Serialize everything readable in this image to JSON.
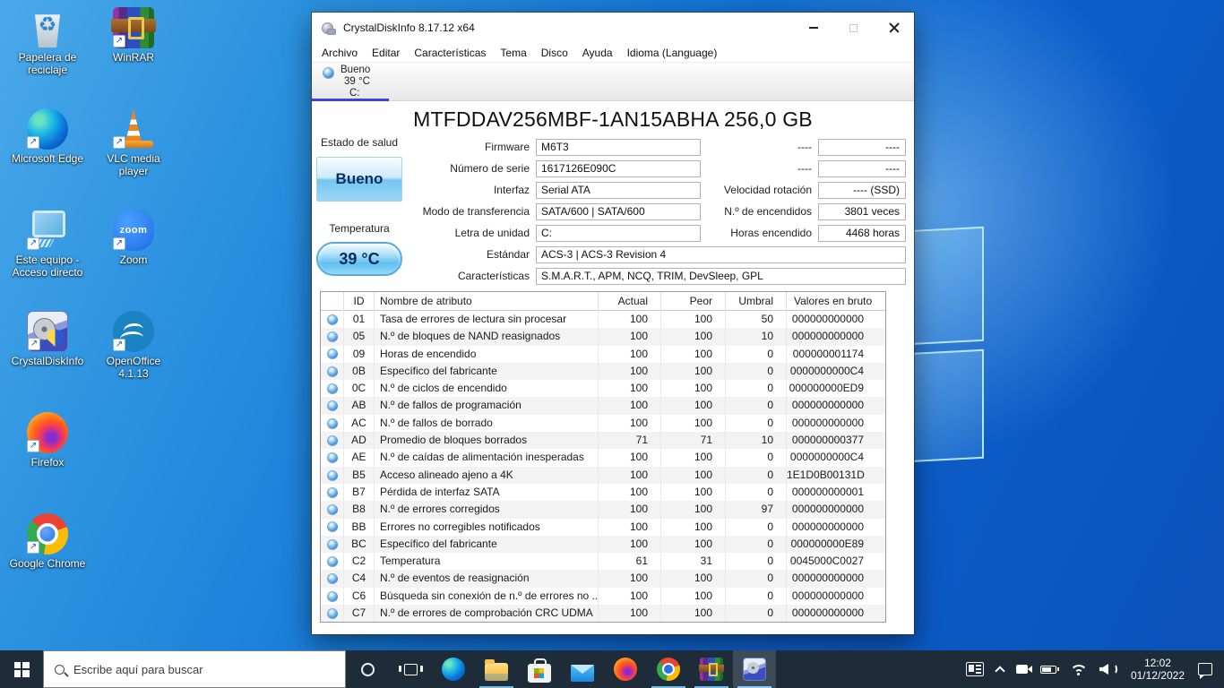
{
  "desktop": {
    "icons": [
      {
        "label": "Papelera de reciclaje",
        "icon": "recycle-bin"
      },
      {
        "label": "Microsoft Edge",
        "icon": "edge"
      },
      {
        "label": "Este equipo - Acceso directo",
        "icon": "this-pc"
      },
      {
        "label": "CrystalDiskInfo",
        "icon": "crystaldiskinfo"
      },
      {
        "label": "Firefox",
        "icon": "firefox"
      },
      {
        "label": "Google Chrome",
        "icon": "chrome"
      },
      {
        "label": "WinRAR",
        "icon": "winrar"
      },
      {
        "label": "VLC media player",
        "icon": "vlc"
      },
      {
        "label": "Zoom",
        "icon": "zoom"
      },
      {
        "label": "OpenOffice 4.1.13",
        "icon": "openoffice"
      }
    ]
  },
  "window": {
    "title": "CrystalDiskInfo 8.17.12 x64",
    "menu": [
      "Archivo",
      "Editar",
      "Características",
      "Tema",
      "Disco",
      "Ayuda",
      "Idioma (Language)"
    ],
    "drive_tab": {
      "health": "Bueno",
      "temp": "39 °C",
      "letter": "C:"
    },
    "disk_title": "MTFDDAV256MBF-1AN15ABHA 256,0 GB",
    "health_label": "Estado de salud",
    "health_value": "Bueno",
    "temp_label": "Temperatura",
    "temp_value": "39 °C",
    "fields": [
      {
        "label": "Firmware",
        "value": "M6T3",
        "wide": ""
      },
      {
        "label": "Número de serie",
        "value": "1617126E090C",
        "wide": ""
      },
      {
        "label": "Interfaz",
        "value": "Serial ATA",
        "wide": ""
      },
      {
        "label": "Modo de transferencia",
        "value": "SATA/600 | SATA/600",
        "wide": ""
      },
      {
        "label": "Letra de unidad",
        "value": "C:",
        "wide": ""
      },
      {
        "label": "Estándar",
        "value": "ACS-3 | ACS-3 Revision 4",
        "wide": "wide"
      },
      {
        "label": "Características",
        "value": "S.M.A.R.T., APM, NCQ, TRIM, DevSleep, GPL",
        "wide": "wide"
      }
    ],
    "right_fields": [
      {
        "label": "----",
        "value": "----"
      },
      {
        "label": "----",
        "value": "----"
      },
      {
        "label": "Velocidad rotación",
        "value": "---- (SSD)"
      },
      {
        "label": "N.º de encendidos",
        "value": "3801 veces"
      },
      {
        "label": "Horas encendido",
        "value": "4468 horas"
      }
    ],
    "table": {
      "headers": {
        "id": "ID",
        "name": "Nombre de atributo",
        "current": "Actual",
        "worst": "Peor",
        "threshold": "Umbral",
        "raw": "Valores en bruto"
      },
      "rows": [
        {
          "id": "01",
          "name": "Tasa de errores de lectura sin procesar",
          "current": "100",
          "worst": "100",
          "threshold": "50",
          "raw": "000000000000"
        },
        {
          "id": "05",
          "name": "N.º de bloques de NAND reasignados",
          "current": "100",
          "worst": "100",
          "threshold": "10",
          "raw": "000000000000"
        },
        {
          "id": "09",
          "name": "Horas de encendido",
          "current": "100",
          "worst": "100",
          "threshold": "0",
          "raw": "000000001174"
        },
        {
          "id": "0B",
          "name": "Específico del fabricante",
          "current": "100",
          "worst": "100",
          "threshold": "0",
          "raw": "0000000000C4"
        },
        {
          "id": "0C",
          "name": "N.º de ciclos de encendido",
          "current": "100",
          "worst": "100",
          "threshold": "0",
          "raw": "000000000ED9"
        },
        {
          "id": "AB",
          "name": "N.º de fallos de programación",
          "current": "100",
          "worst": "100",
          "threshold": "0",
          "raw": "000000000000"
        },
        {
          "id": "AC",
          "name": "N.º de fallos de borrado",
          "current": "100",
          "worst": "100",
          "threshold": "0",
          "raw": "000000000000"
        },
        {
          "id": "AD",
          "name": "Promedio de bloques borrados",
          "current": "71",
          "worst": "71",
          "threshold": "10",
          "raw": "000000000377"
        },
        {
          "id": "AE",
          "name": "N.º de caídas de alimentación inesperadas",
          "current": "100",
          "worst": "100",
          "threshold": "0",
          "raw": "0000000000C4"
        },
        {
          "id": "B5",
          "name": "Acceso alineado ajeno a 4K",
          "current": "100",
          "worst": "100",
          "threshold": "0",
          "raw": "1E1D0B00131D"
        },
        {
          "id": "B7",
          "name": "Pérdida de interfaz SATA",
          "current": "100",
          "worst": "100",
          "threshold": "0",
          "raw": "000000000001"
        },
        {
          "id": "B8",
          "name": "N.º de errores corregidos",
          "current": "100",
          "worst": "100",
          "threshold": "97",
          "raw": "000000000000"
        },
        {
          "id": "BB",
          "name": "Errores no corregibles notificados",
          "current": "100",
          "worst": "100",
          "threshold": "0",
          "raw": "000000000000"
        },
        {
          "id": "BC",
          "name": "Específico del fabricante",
          "current": "100",
          "worst": "100",
          "threshold": "0",
          "raw": "000000000E89"
        },
        {
          "id": "C2",
          "name": "Temperatura",
          "current": "61",
          "worst": "31",
          "threshold": "0",
          "raw": "0045000C0027"
        },
        {
          "id": "C4",
          "name": "N.º de eventos de reasignación",
          "current": "100",
          "worst": "100",
          "threshold": "0",
          "raw": "000000000000"
        },
        {
          "id": "C6",
          "name": "Búsqueda sin conexión de n.º de errores no ...",
          "current": "100",
          "worst": "100",
          "threshold": "0",
          "raw": "000000000000"
        },
        {
          "id": "C7",
          "name": "N.º de errores de comprobación CRC UDMA",
          "current": "100",
          "worst": "100",
          "threshold": "0",
          "raw": "000000000000"
        }
      ]
    }
  },
  "taskbar": {
    "search_placeholder": "Escribe aquí para buscar",
    "clock_time": "12:02",
    "clock_date": "01/12/2022",
    "icons": [
      "start",
      "search",
      "cortana",
      "task-view",
      "edge",
      "file-explorer",
      "store",
      "mail",
      "firefox",
      "chrome",
      "winrar",
      "crystaldiskinfo",
      "news",
      "tray-expand",
      "meet-now",
      "battery",
      "wifi",
      "volume",
      "clock",
      "action-center"
    ]
  }
}
